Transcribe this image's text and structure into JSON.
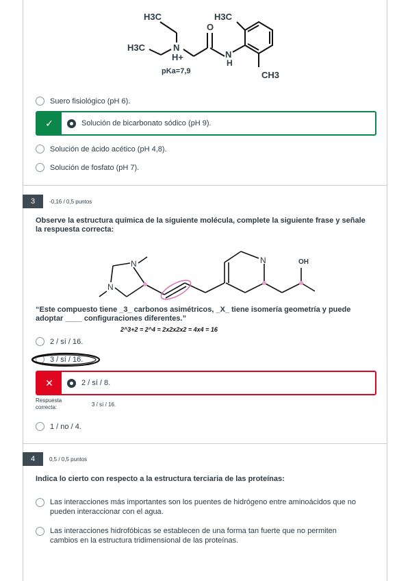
{
  "q2": {
    "molecule": {
      "h3c_1": "H3C",
      "h3c_2": "H3C",
      "h3c_3": "H3C",
      "n_plus": "N",
      "h_plus": "H+",
      "o": "O",
      "n_amide": "N",
      "h_amide": "H",
      "ch3": "CH3",
      "pka": "pKa=7,9"
    },
    "options": [
      {
        "label": "Suero fisiológico (pH 6).",
        "selected": false
      },
      {
        "label": "Solución de bicarbonato sódico (pH 9).",
        "selected": true,
        "correct": true
      },
      {
        "label": "Solución de ácido acético (pH 4,8).",
        "selected": false
      },
      {
        "label": "Solución de fosfato (pH 7).",
        "selected": false
      }
    ]
  },
  "q3": {
    "number": "3",
    "points": "-0,16 / 0,5 puntos",
    "question_line1": "Observe la estructura química de la siguiente molécula, complete la siguiente frase y señale",
    "question_line2": "la respuesta correcta:",
    "molecule": {
      "n1": "N",
      "n2": "N",
      "n3": "N",
      "oh": "OH"
    },
    "sentence_line1": "“Este compuesto tiene _3_ carbonos asimétricos, _X_ tiene isomería geometría y puede",
    "sentence_line2": "adoptar ____ configuraciones diferentes.”",
    "handwriting": "2^3+2 = 2^4 = 2x2x2x2 = 4x4 = 16",
    "options": [
      {
        "label": "2 / sí / 16.",
        "selected": false
      },
      {
        "label": "3 / sí / 16.",
        "selected": false
      },
      {
        "label": "2 / sí / 8.",
        "selected": true,
        "correct": false
      },
      {
        "label": "1 / no / 4.",
        "selected": false
      }
    ],
    "correct_label_1": "Respuesta",
    "correct_label_2": "correcta:",
    "correct_answer": "3 / sí / 16."
  },
  "q4": {
    "number": "4",
    "points": "0,5 / 0,5 puntos",
    "question": "Indica lo cierto con respecto a la estructura terciaria de las proteínas:",
    "options": [
      {
        "line1": "Las interacciones más importantes son los puentes de hidrógeno entre aminoácidos que no",
        "line2": "pueden interaccionar con el agua."
      },
      {
        "line1": "Las interacciones hidrofóbicas se establecen de una forma tan fuerte que no permiten",
        "line2": "cambios en la estructura tridimensional de las proteínas."
      }
    ]
  },
  "colors": {
    "correct": "#0b874b",
    "incorrect": "#e0061f",
    "text": "#2d3b45"
  }
}
